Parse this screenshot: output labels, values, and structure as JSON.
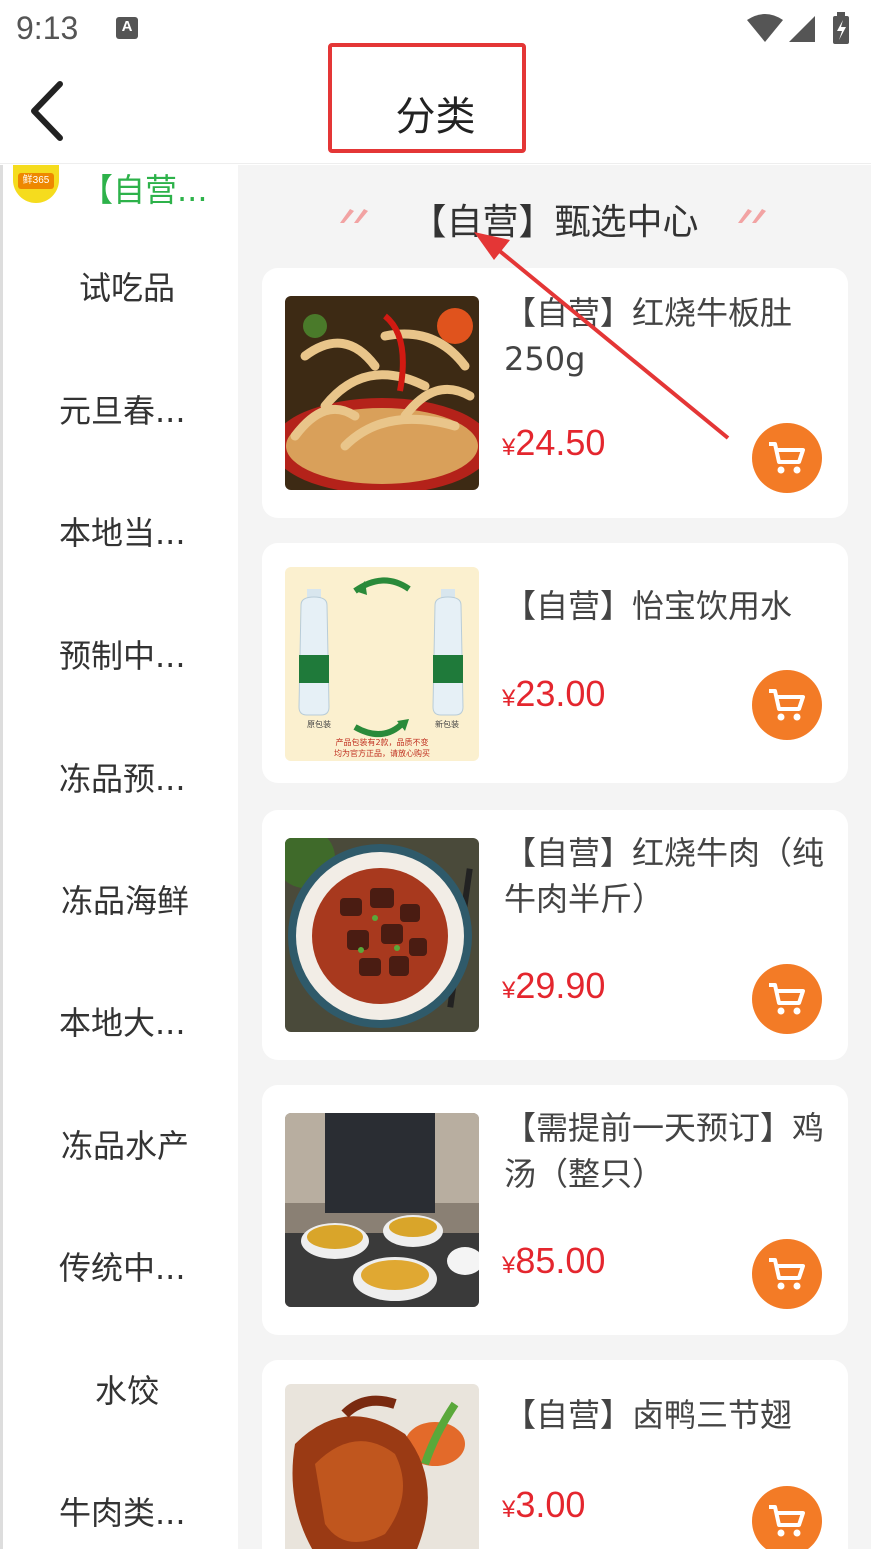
{
  "status_bar": {
    "time": "9:13",
    "notification_icon": "A"
  },
  "header": {
    "title": "分类",
    "back_icon": "chevron-left-icon"
  },
  "sidebar": {
    "active": {
      "label": "【自营...",
      "logo_text": "鲜365"
    },
    "items": [
      {
        "label": "试吃品"
      },
      {
        "label": "元旦春..."
      },
      {
        "label": "本地当..."
      },
      {
        "label": "预制中..."
      },
      {
        "label": "冻品预..."
      },
      {
        "label": "冻品海鲜"
      },
      {
        "label": "本地大..."
      },
      {
        "label": "冻品水产"
      },
      {
        "label": "传统中..."
      },
      {
        "label": "水饺"
      },
      {
        "label": "牛肉类..."
      }
    ]
  },
  "section": {
    "title": "【自营】甄选中心"
  },
  "products": [
    {
      "name": "【自营】红烧牛板肚250g",
      "currency": "¥",
      "price": "24.50",
      "image": "braised-beef-tripe"
    },
    {
      "name": "【自营】怡宝饮用水",
      "currency": "¥",
      "price": "23.00",
      "image": "bottled-water",
      "image_caption_left": "原包装",
      "image_caption_right": "新包装",
      "image_note_1": "产品包装有2款，品质不变",
      "image_note_2": "均为官方正品，请放心购买"
    },
    {
      "name": "【自营】红烧牛肉（纯牛肉半斤）",
      "currency": "¥",
      "price": "29.90",
      "image": "braised-beef"
    },
    {
      "name": "【需提前一天预订】鸡汤（整只）",
      "currency": "¥",
      "price": "85.00",
      "image": "chicken-soup"
    },
    {
      "name": "【自营】卤鸭三节翅",
      "currency": "¥",
      "price": "3.00",
      "image": "braised-duck-wings"
    }
  ],
  "colors": {
    "accent": "#f37b26",
    "price": "#e4262e",
    "active_category": "#2db24a",
    "annotation": "#e43636"
  }
}
